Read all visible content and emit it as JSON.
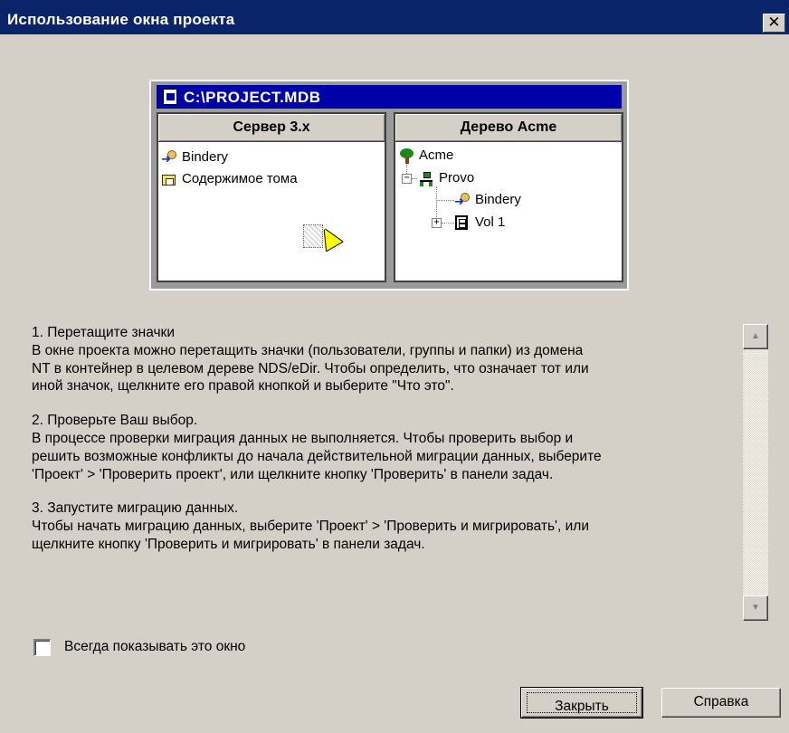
{
  "window": {
    "title": "Использование окна проекта",
    "close_glyph": "✕"
  },
  "illustration": {
    "db_title": "C:\\PROJECT.MDB",
    "left_pane": {
      "header": "Сервер 3.x",
      "items": [
        "Bindery",
        "Содержимое тома"
      ]
    },
    "right_pane": {
      "header": "Дерево Acme",
      "items": [
        "Acme",
        "Provo",
        "Bindery",
        "Vol 1"
      ]
    },
    "icons": [
      "database-icon",
      "bindery-icon",
      "folder-icon",
      "tree-icon",
      "organization-icon",
      "volume-icon",
      "drag-ghost-icon",
      "cursor-icon"
    ]
  },
  "help": {
    "sections": [
      {
        "heading": "1. Перетащите значки",
        "lines": [
          "В окне проекта можно перетащить значки (пользователи, группы и папки) из домена",
          "NT в контейнер в целевом дереве NDS/eDir. Чтобы определить, что означает тот или",
          "иной значок, щелкните его правой кнопкой и выберите \"Что это\"."
        ]
      },
      {
        "heading": "2. Проверьте Ваш выбор.",
        "lines": [
          "В процессе проверки миграция данных не выполняется. Чтобы проверить выбор и",
          "решить возможные конфликты до начала действительной миграции данных, выберите",
          "'Проект' > 'Проверить проект', или щелкните кнопку 'Проверить' в панели задач."
        ]
      },
      {
        "heading": "3. Запустите миграцию данных.",
        "lines": [
          "Чтобы начать миграцию данных, выберите 'Проект' > 'Проверить и мигрировать', или",
          "щелкните кнопку 'Проверить и мигрировать' в панели задач."
        ]
      }
    ]
  },
  "scrollbar": {
    "up_glyph": "▲",
    "down_glyph": "▼"
  },
  "options": {
    "always_show_label": "Всегда показывать это окно",
    "always_show_checked": false
  },
  "buttons": {
    "close_label": "Закрыть",
    "help_label": "Справка"
  }
}
